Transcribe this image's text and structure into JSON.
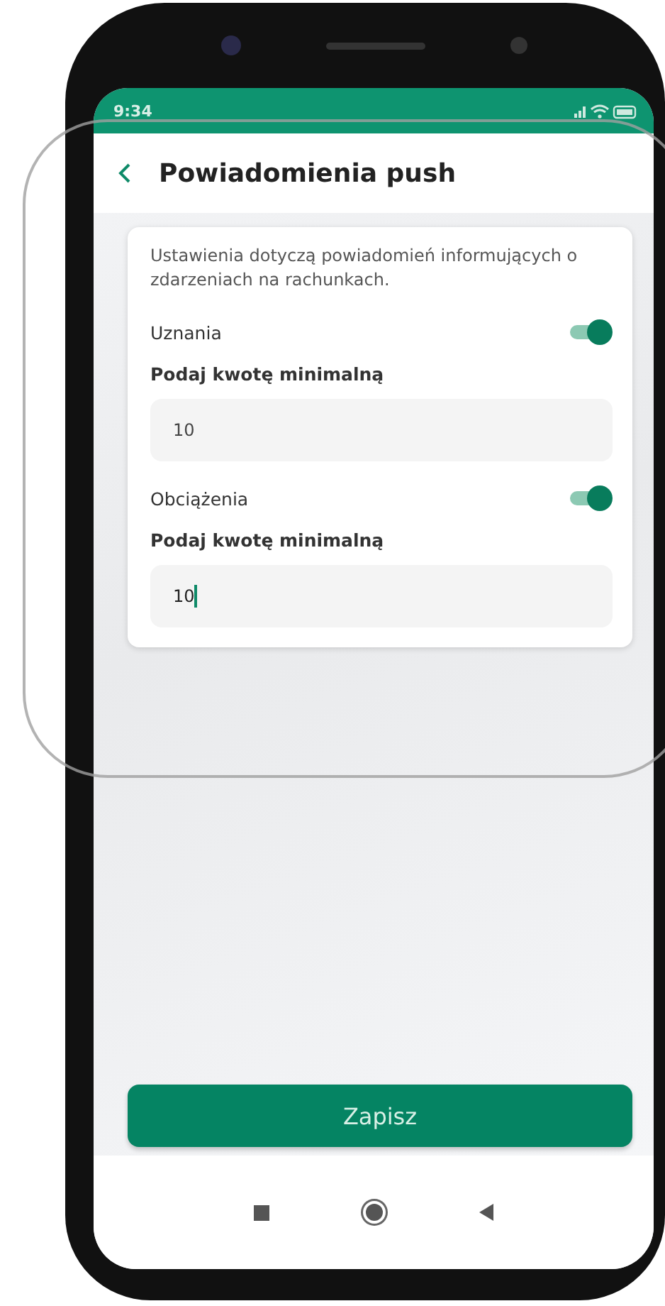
{
  "status_bar": {
    "time": "9:34"
  },
  "header": {
    "title": "Powiadomienia push"
  },
  "card": {
    "description": "Ustawienia dotyczą powiadomień informujących o zdarzeniach na rachunkach.",
    "sections": [
      {
        "label": "Uznania",
        "on": true,
        "field_label": "Podaj kwotę minimalną",
        "value": "10",
        "focused": false
      },
      {
        "label": "Obciążenia",
        "on": true,
        "field_label": "Podaj kwotę minimalną",
        "value": "10",
        "focused": true
      }
    ]
  },
  "save_button": "Zapisz"
}
